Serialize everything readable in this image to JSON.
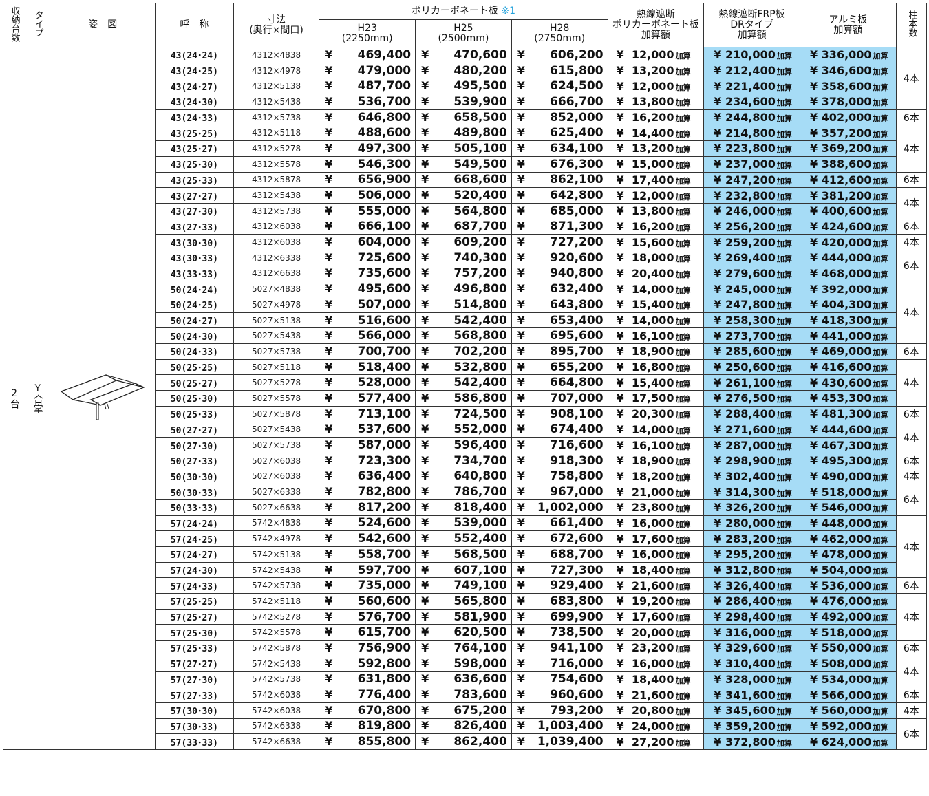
{
  "header": {
    "col_capacity": "収納台数",
    "col_type": "タイプ",
    "col_figure": "姿　図",
    "col_name": "呼　称",
    "col_dim_line1": "寸法",
    "col_dim_line2": "(奥行×間口)",
    "col_poly": "ポリカーボネート板",
    "col_poly_note": "※1",
    "col_h23": "H23",
    "col_h23_sub": "(2250mm)",
    "col_h25": "H25",
    "col_h25_sub": "(2500mm)",
    "col_h28": "H28",
    "col_h28_sub": "(2750mm)",
    "col_heat_poly_l1": "熱線遮断",
    "col_heat_poly_l2": "ポリカーボネート板",
    "col_heat_poly_l3": "加算額",
    "col_frp_l1": "熱線遮断FRP板",
    "col_frp_l2": "DRタイプ",
    "col_frp_l3": "加算額",
    "col_alu_l1": "アルミ板",
    "col_alu_l2": "加算額",
    "col_posts": "柱本数"
  },
  "group": {
    "capacity": "2台",
    "type": "Y合掌",
    "figure": "y-gassho-carport-icon"
  },
  "yen": "¥",
  "add_label": "加算",
  "rows": [
    {
      "name": "43(24･24)",
      "dim": "4312×4838",
      "h23": "469,400",
      "h25": "470,600",
      "h28": "606,200",
      "hp": "12,000",
      "frp": "¥ 210,000",
      "alu": "¥ 336,000"
    },
    {
      "name": "43(24･25)",
      "dim": "4312×4978",
      "h23": "479,000",
      "h25": "480,200",
      "h28": "615,800",
      "hp": "13,200",
      "frp": "¥ 212,400",
      "alu": "¥ 346,600"
    },
    {
      "name": "43(24･27)",
      "dim": "4312×5138",
      "h23": "487,700",
      "h25": "495,500",
      "h28": "624,500",
      "hp": "12,000",
      "frp": "¥ 221,400",
      "alu": "¥ 358,600"
    },
    {
      "name": "43(24･30)",
      "dim": "4312×5438",
      "h23": "536,700",
      "h25": "539,900",
      "h28": "666,700",
      "hp": "13,800",
      "frp": "¥ 234,600",
      "alu": "¥ 378,000"
    },
    {
      "name": "43(24･33)",
      "dim": "4312×5738",
      "h23": "646,800",
      "h25": "658,500",
      "h28": "852,000",
      "hp": "16,200",
      "frp": "¥ 244,800",
      "alu": "¥ 402,000"
    },
    {
      "name": "43(25･25)",
      "dim": "4312×5118",
      "h23": "488,600",
      "h25": "489,800",
      "h28": "625,400",
      "hp": "14,400",
      "frp": "¥ 214,800",
      "alu": "¥ 357,200"
    },
    {
      "name": "43(25･27)",
      "dim": "4312×5278",
      "h23": "497,300",
      "h25": "505,100",
      "h28": "634,100",
      "hp": "13,200",
      "frp": "¥ 223,800",
      "alu": "¥ 369,200"
    },
    {
      "name": "43(25･30)",
      "dim": "4312×5578",
      "h23": "546,300",
      "h25": "549,500",
      "h28": "676,300",
      "hp": "15,000",
      "frp": "¥ 237,000",
      "alu": "¥ 388,600"
    },
    {
      "name": "43(25･33)",
      "dim": "4312×5878",
      "h23": "656,900",
      "h25": "668,600",
      "h28": "862,100",
      "hp": "17,400",
      "frp": "¥ 247,200",
      "alu": "¥ 412,600"
    },
    {
      "name": "43(27･27)",
      "dim": "4312×5438",
      "h23": "506,000",
      "h25": "520,400",
      "h28": "642,800",
      "hp": "12,000",
      "frp": "¥ 232,800",
      "alu": "¥ 381,200"
    },
    {
      "name": "43(27･30)",
      "dim": "4312×5738",
      "h23": "555,000",
      "h25": "564,800",
      "h28": "685,000",
      "hp": "13,800",
      "frp": "¥ 246,000",
      "alu": "¥ 400,600"
    },
    {
      "name": "43(27･33)",
      "dim": "4312×6038",
      "h23": "666,100",
      "h25": "687,700",
      "h28": "871,300",
      "hp": "16,200",
      "frp": "¥ 256,200",
      "alu": "¥ 424,600"
    },
    {
      "name": "43(30･30)",
      "dim": "4312×6038",
      "h23": "604,000",
      "h25": "609,200",
      "h28": "727,200",
      "hp": "15,600",
      "frp": "¥ 259,200",
      "alu": "¥ 420,000"
    },
    {
      "name": "43(30･33)",
      "dim": "4312×6338",
      "h23": "725,600",
      "h25": "740,300",
      "h28": "920,600",
      "hp": "18,000",
      "frp": "¥ 269,400",
      "alu": "¥ 444,000"
    },
    {
      "name": "43(33･33)",
      "dim": "4312×6638",
      "h23": "735,600",
      "h25": "757,200",
      "h28": "940,800",
      "hp": "20,400",
      "frp": "¥ 279,600",
      "alu": "¥ 468,000"
    },
    {
      "name": "50(24･24)",
      "dim": "5027×4838",
      "h23": "495,600",
      "h25": "496,800",
      "h28": "632,400",
      "hp": "14,000",
      "frp": "¥ 245,000",
      "alu": "¥ 392,000"
    },
    {
      "name": "50(24･25)",
      "dim": "5027×4978",
      "h23": "507,000",
      "h25": "514,800",
      "h28": "643,800",
      "hp": "15,400",
      "frp": "¥ 247,800",
      "alu": "¥ 404,300"
    },
    {
      "name": "50(24･27)",
      "dim": "5027×5138",
      "h23": "516,600",
      "h25": "542,400",
      "h28": "653,400",
      "hp": "14,000",
      "frp": "¥ 258,300",
      "alu": "¥ 418,300"
    },
    {
      "name": "50(24･30)",
      "dim": "5027×5438",
      "h23": "566,000",
      "h25": "568,800",
      "h28": "695,600",
      "hp": "16,100",
      "frp": "¥ 273,700",
      "alu": "¥ 441,000"
    },
    {
      "name": "50(24･33)",
      "dim": "5027×5738",
      "h23": "700,700",
      "h25": "702,200",
      "h28": "895,700",
      "hp": "18,900",
      "frp": "¥ 285,600",
      "alu": "¥ 469,000"
    },
    {
      "name": "50(25･25)",
      "dim": "5027×5118",
      "h23": "518,400",
      "h25": "532,800",
      "h28": "655,200",
      "hp": "16,800",
      "frp": "¥ 250,600",
      "alu": "¥ 416,600"
    },
    {
      "name": "50(25･27)",
      "dim": "5027×5278",
      "h23": "528,000",
      "h25": "542,400",
      "h28": "664,800",
      "hp": "15,400",
      "frp": "¥ 261,100",
      "alu": "¥ 430,600"
    },
    {
      "name": "50(25･30)",
      "dim": "5027×5578",
      "h23": "577,400",
      "h25": "586,800",
      "h28": "707,000",
      "hp": "17,500",
      "frp": "¥ 276,500",
      "alu": "¥ 453,300"
    },
    {
      "name": "50(25･33)",
      "dim": "5027×5878",
      "h23": "713,100",
      "h25": "724,500",
      "h28": "908,100",
      "hp": "20,300",
      "frp": "¥ 288,400",
      "alu": "¥ 481,300"
    },
    {
      "name": "50(27･27)",
      "dim": "5027×5438",
      "h23": "537,600",
      "h25": "552,000",
      "h28": "674,400",
      "hp": "14,000",
      "frp": "¥ 271,600",
      "alu": "¥ 444,600"
    },
    {
      "name": "50(27･30)",
      "dim": "5027×5738",
      "h23": "587,000",
      "h25": "596,400",
      "h28": "716,600",
      "hp": "16,100",
      "frp": "¥ 287,000",
      "alu": "¥ 467,300"
    },
    {
      "name": "50(27･33)",
      "dim": "5027×6038",
      "h23": "723,300",
      "h25": "734,700",
      "h28": "918,300",
      "hp": "18,900",
      "frp": "¥ 298,900",
      "alu": "¥ 495,300"
    },
    {
      "name": "50(30･30)",
      "dim": "5027×6038",
      "h23": "636,400",
      "h25": "640,800",
      "h28": "758,800",
      "hp": "18,200",
      "frp": "¥ 302,400",
      "alu": "¥ 490,000"
    },
    {
      "name": "50(30･33)",
      "dim": "5027×6338",
      "h23": "782,800",
      "h25": "786,700",
      "h28": "967,000",
      "hp": "21,000",
      "frp": "¥ 314,300",
      "alu": "¥ 518,000"
    },
    {
      "name": "50(33･33)",
      "dim": "5027×6638",
      "h23": "817,200",
      "h25": "818,400",
      "h28": "1,002,000",
      "hp": "23,800",
      "frp": "¥ 326,200",
      "alu": "¥ 546,000"
    },
    {
      "name": "57(24･24)",
      "dim": "5742×4838",
      "h23": "524,600",
      "h25": "539,000",
      "h28": "661,400",
      "hp": "16,000",
      "frp": "¥ 280,000",
      "alu": "¥ 448,000"
    },
    {
      "name": "57(24･25)",
      "dim": "5742×4978",
      "h23": "542,600",
      "h25": "552,400",
      "h28": "672,600",
      "hp": "17,600",
      "frp": "¥ 283,200",
      "alu": "¥ 462,000"
    },
    {
      "name": "57(24･27)",
      "dim": "5742×5138",
      "h23": "558,700",
      "h25": "568,500",
      "h28": "688,700",
      "hp": "16,000",
      "frp": "¥ 295,200",
      "alu": "¥ 478,000"
    },
    {
      "name": "57(24･30)",
      "dim": "5742×5438",
      "h23": "597,700",
      "h25": "607,100",
      "h28": "727,300",
      "hp": "18,400",
      "frp": "¥ 312,800",
      "alu": "¥ 504,000"
    },
    {
      "name": "57(24･33)",
      "dim": "5742×5738",
      "h23": "735,000",
      "h25": "749,100",
      "h28": "929,400",
      "hp": "21,600",
      "frp": "¥ 326,400",
      "alu": "¥ 536,000"
    },
    {
      "name": "57(25･25)",
      "dim": "5742×5118",
      "h23": "560,600",
      "h25": "565,800",
      "h28": "683,800",
      "hp": "19,200",
      "frp": "¥ 286,400",
      "alu": "¥ 476,000"
    },
    {
      "name": "57(25･27)",
      "dim": "5742×5278",
      "h23": "576,700",
      "h25": "581,900",
      "h28": "699,900",
      "hp": "17,600",
      "frp": "¥ 298,400",
      "alu": "¥ 492,000"
    },
    {
      "name": "57(25･30)",
      "dim": "5742×5578",
      "h23": "615,700",
      "h25": "620,500",
      "h28": "738,500",
      "hp": "20,000",
      "frp": "¥ 316,000",
      "alu": "¥ 518,000"
    },
    {
      "name": "57(25･33)",
      "dim": "5742×5878",
      "h23": "756,900",
      "h25": "764,100",
      "h28": "941,100",
      "hp": "23,200",
      "frp": "¥ 329,600",
      "alu": "¥ 550,000"
    },
    {
      "name": "57(27･27)",
      "dim": "5742×5438",
      "h23": "592,800",
      "h25": "598,000",
      "h28": "716,000",
      "hp": "16,000",
      "frp": "¥ 310,400",
      "alu": "¥ 508,000"
    },
    {
      "name": "57(27･30)",
      "dim": "5742×5738",
      "h23": "631,800",
      "h25": "636,600",
      "h28": "754,600",
      "hp": "18,400",
      "frp": "¥ 328,000",
      "alu": "¥ 534,000"
    },
    {
      "name": "57(27･33)",
      "dim": "5742×6038",
      "h23": "776,400",
      "h25": "783,600",
      "h28": "960,600",
      "hp": "21,600",
      "frp": "¥ 341,600",
      "alu": "¥ 566,000"
    },
    {
      "name": "57(30･30)",
      "dim": "5742×6038",
      "h23": "670,800",
      "h25": "675,200",
      "h28": "793,200",
      "hp": "20,800",
      "frp": "¥ 345,600",
      "alu": "¥ 560,000"
    },
    {
      "name": "57(30･33)",
      "dim": "5742×6338",
      "h23": "819,800",
      "h25": "826,400",
      "h28": "1,003,400",
      "hp": "24,000",
      "frp": "¥ 359,200",
      "alu": "¥ 592,000"
    },
    {
      "name": "57(33･33)",
      "dim": "5742×6638",
      "h23": "855,800",
      "h25": "862,400",
      "h28": "1,039,400",
      "hp": "27,200",
      "frp": "¥ 372,800",
      "alu": "¥ 624,000"
    }
  ],
  "posts": [
    {
      "label": "4本",
      "span": 4
    },
    {
      "label": "6本",
      "span": 1
    },
    {
      "label": "4本",
      "span": 3
    },
    {
      "label": "6本",
      "span": 1
    },
    {
      "label": "4本",
      "span": 2
    },
    {
      "label": "6本",
      "span": 1
    },
    {
      "label": "4本",
      "span": 1
    },
    {
      "label": "6本",
      "span": 2
    },
    {
      "label": "4本",
      "span": 4
    },
    {
      "label": "6本",
      "span": 1
    },
    {
      "label": "4本",
      "span": 3
    },
    {
      "label": "6本",
      "span": 1
    },
    {
      "label": "4本",
      "span": 2
    },
    {
      "label": "6本",
      "span": 1
    },
    {
      "label": "4本",
      "span": 1
    },
    {
      "label": "6本",
      "span": 2
    },
    {
      "label": "4本",
      "span": 4
    },
    {
      "label": "6本",
      "span": 1
    },
    {
      "label": "4本",
      "span": 3
    },
    {
      "label": "6本",
      "span": 1
    },
    {
      "label": "4本",
      "span": 2
    },
    {
      "label": "6本",
      "span": 1
    },
    {
      "label": "4本",
      "span": 1
    },
    {
      "label": "6本",
      "span": 2
    }
  ]
}
